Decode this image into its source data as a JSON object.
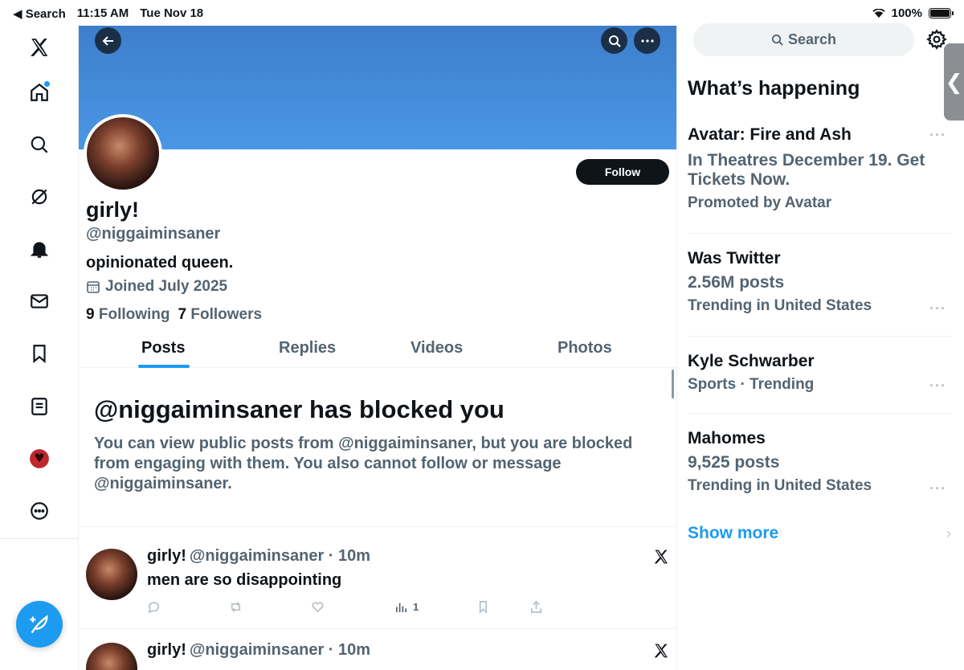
{
  "status_bar": {
    "back_label": "◀ Search",
    "time": "11:15 AM",
    "date": "Tue Nov 18",
    "battery": "100%"
  },
  "profile": {
    "name": "girly!",
    "handle": "@niggaiminsaner",
    "bio": "opinionated queen.",
    "joined": "Joined July 2025",
    "following_count": "9",
    "following_label": "Following",
    "followers_count": "7",
    "followers_label": "Followers",
    "follow_button": "Follow"
  },
  "tabs": [
    "Posts",
    "Replies",
    "Videos",
    "Photos"
  ],
  "blocked": {
    "title": "@niggaiminsaner has blocked you",
    "text": "You can view public posts from @niggaiminsaner, but you are blocked from engaging with them. You also cannot follow or message @niggaiminsaner."
  },
  "posts": [
    {
      "name": "girly!",
      "meta": "@niggaiminsaner · 10m",
      "body": "men are so disappointing",
      "views": "1"
    },
    {
      "name": "girly!",
      "meta": "@niggaiminsaner · 10m",
      "body": ""
    }
  ],
  "sidebar": {
    "search_label": "Search",
    "whats_happening": "What’s happening",
    "trends": [
      {
        "line1": "Avatar: Fire and Ash",
        "line2": "In Theatres December 19. Get Tickets Now.",
        "line3": "Promoted by Avatar"
      },
      {
        "line1": "Was Twitter",
        "line2": "2.56M posts",
        "line3": "Trending in United States"
      },
      {
        "line1": "Kyle Schwarber",
        "line2": "Sports · Trending",
        "line3": ""
      },
      {
        "line1": "Mahomes",
        "line2": "9,525 posts",
        "line3": "Trending in United States"
      }
    ],
    "show_more": "Show more"
  },
  "colors": {
    "accent": "#1d9bf0",
    "banner": "#4a97e6",
    "text_primary": "#0f1419",
    "text_secondary": "#536471"
  }
}
